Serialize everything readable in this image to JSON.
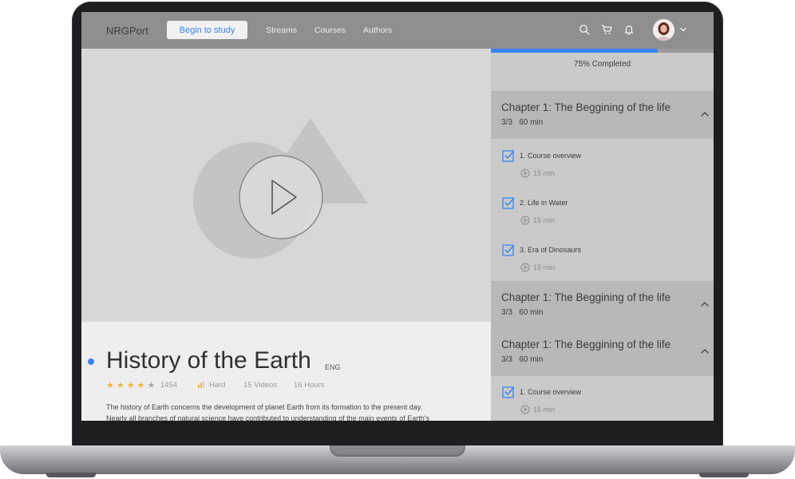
{
  "header": {
    "logo": "NRGPort",
    "begin_button": "Begin to study",
    "nav": [
      "Streams",
      "Courses",
      "Authors"
    ]
  },
  "course": {
    "title": "History of the Earth",
    "language": "ENG",
    "rating_stars": 4,
    "rating_count": "1454",
    "difficulty": "Hard",
    "videos": "15 Videos",
    "hours": "16 Hours",
    "description_line1": "The history of Earth concerns the development of planet Earth from its formation to the present day.",
    "description_line2": "Nearly all branches of natural science have contributed to understanding of the main events of Earth's"
  },
  "progress": {
    "fraction": 0.75,
    "label": "75% Completed"
  },
  "chapters": [
    {
      "title": "Chapter 1: The Beggining of the life",
      "count": "3/3",
      "duration": "60 min",
      "lessons": [
        {
          "label": "1. Course overview",
          "duration": "15 min"
        },
        {
          "label": "2. Life in Water",
          "duration": "15 min"
        },
        {
          "label": "3. Era of Dinosaurs",
          "duration": "15 min"
        }
      ]
    },
    {
      "title": "Chapter 1: The Beggining of the life",
      "count": "3/3",
      "duration": "60 min",
      "lessons": []
    },
    {
      "title": "Chapter 1: The Beggining of the life",
      "count": "3/3",
      "duration": "60 min",
      "lessons": [
        {
          "label": "1. Course overview",
          "duration": "15 min"
        }
      ]
    }
  ],
  "colors": {
    "accent": "#3a82f0",
    "star": "#f2b632",
    "header_bg": "#8f8f8f",
    "sidebar_bg": "#cacaca",
    "chapter_bg": "#b8b8b8"
  },
  "icons": [
    "search-icon",
    "cart-icon",
    "bell-icon",
    "chevron-down-icon",
    "play-icon",
    "checkbox-icon",
    "chevron-up-icon",
    "bars-icon",
    "star-icon"
  ]
}
